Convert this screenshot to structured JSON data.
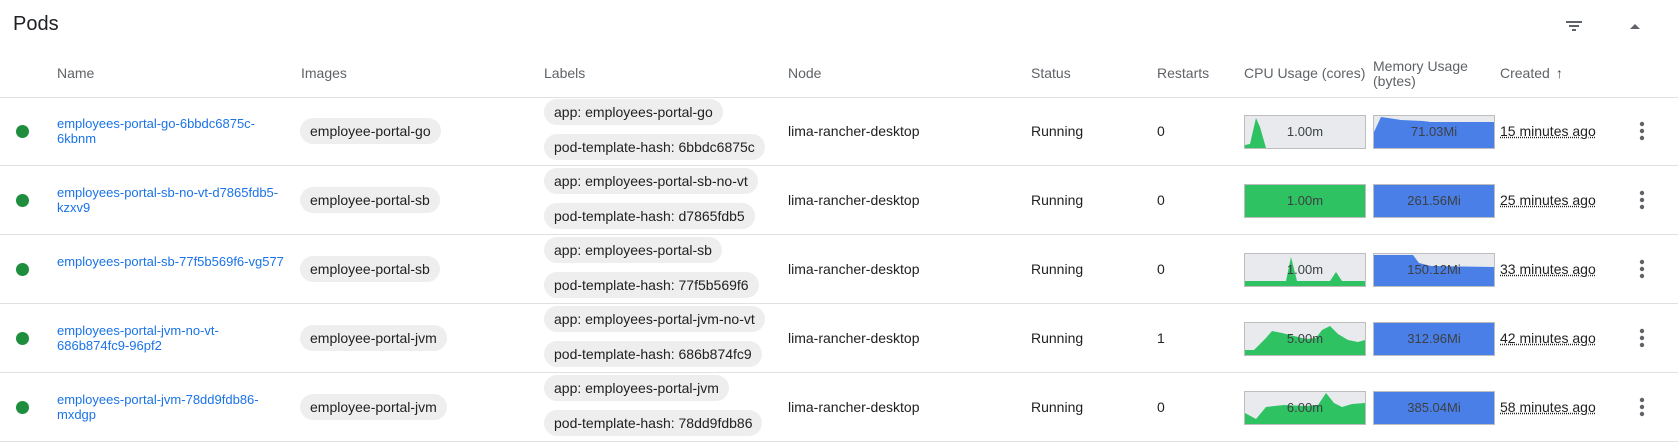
{
  "card": {
    "title": "Pods",
    "filter_icon": "filter-icon",
    "collapse_icon": "expand-less-icon"
  },
  "columns": {
    "name": "Name",
    "images": "Images",
    "labels": "Labels",
    "node": "Node",
    "status": "Status",
    "restarts": "Restarts",
    "cpu": "CPU Usage (cores)",
    "memory_line1": "Memory Usage",
    "memory_line2": "(bytes)",
    "created": "Created",
    "created_sort": "↑"
  },
  "colors": {
    "running": "#1e8e3e",
    "cpu_fill": "#2fc262",
    "cpu_bg": "#e8eaed",
    "mem_fill": "#4a7fe8",
    "link": "#1a73e8"
  },
  "rows": [
    {
      "name": "employees-portal-go-6bbdc6875c-6kbnm",
      "image": "employee-portal-go",
      "label_app": "app: employees-portal-go",
      "label_hash": "pod-template-hash: 6bbdc6875c",
      "node": "lima-rancher-desktop",
      "status": "Running",
      "restarts": "0",
      "cpu": "1.00m",
      "memory": "71.03Mi",
      "created": "15 minutes ago"
    },
    {
      "name": "employees-portal-sb-no-vt-d7865fdb5-kzxv9",
      "image": "employee-portal-sb",
      "label_app": "app: employees-portal-sb-no-vt",
      "label_hash": "pod-template-hash: d7865fdb5",
      "node": "lima-rancher-desktop",
      "status": "Running",
      "restarts": "0",
      "cpu": "1.00m",
      "memory": "261.56Mi",
      "created": "25 minutes ago"
    },
    {
      "name": "employees-portal-sb-77f5b569f6-vg577",
      "image": "employee-portal-sb",
      "label_app": "app: employees-portal-sb",
      "label_hash": "pod-template-hash: 77f5b569f6",
      "node": "lima-rancher-desktop",
      "status": "Running",
      "restarts": "0",
      "cpu": "1.00m",
      "memory": "150.12Mi",
      "created": "33 minutes ago"
    },
    {
      "name": "employees-portal-jvm-no-vt-686b874fc9-96pf2",
      "image": "employee-portal-jvm",
      "label_app": "app: employees-portal-jvm-no-vt",
      "label_hash": "pod-template-hash: 686b874fc9",
      "node": "lima-rancher-desktop",
      "status": "Running",
      "restarts": "1",
      "cpu": "5.00m",
      "memory": "312.96Mi",
      "created": "42 minutes ago"
    },
    {
      "name": "employees-portal-jvm-78dd9fdb86-mxdgp",
      "image": "employee-portal-jvm",
      "label_app": "app: employees-portal-jvm",
      "label_hash": "pod-template-hash: 78dd9fdb86",
      "node": "lima-rancher-desktop",
      "status": "Running",
      "restarts": "0",
      "cpu": "6.00m",
      "memory": "385.04Mi",
      "created": "58 minutes ago"
    }
  ]
}
